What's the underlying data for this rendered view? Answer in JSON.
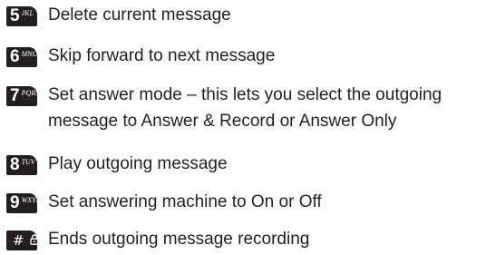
{
  "entries": [
    {
      "key_digit": "5",
      "key_letters": "JKL",
      "text": "Delete current message"
    },
    {
      "key_digit": "6",
      "key_letters": "MNO",
      "text": "Skip forward to next message"
    },
    {
      "key_digit": "7",
      "key_letters": "PQRS",
      "text_line1": "Set answer mode – this lets you select the outgoing",
      "text_line2": "message to Answer & Record or Answer Only"
    },
    {
      "key_digit": "8",
      "key_letters": "TUV",
      "text": "Play outgoing message"
    },
    {
      "key_digit": "9",
      "key_letters": "WXYZ",
      "text": "Set answering machine to On or Off"
    },
    {
      "key_symbol": "#",
      "key_icon": "lock-icon",
      "text": "Ends outgoing message recording"
    }
  ]
}
